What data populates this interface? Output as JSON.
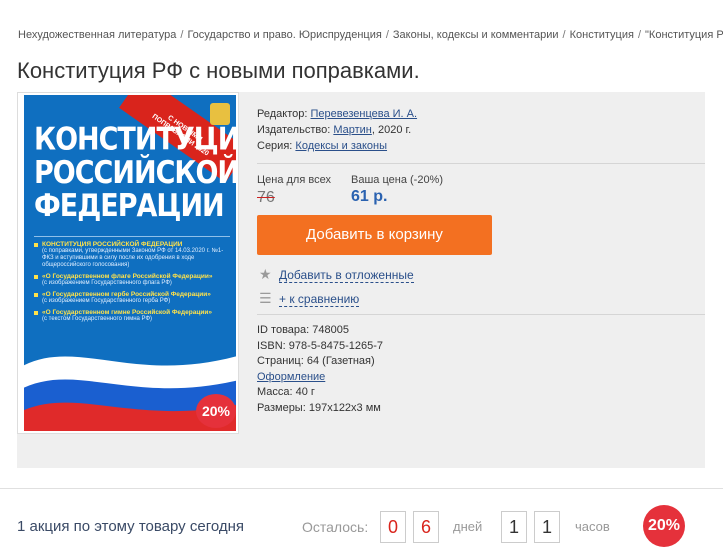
{
  "breadcrumbs": [
    "Нехудожественная литература",
    "Государство и право. Юриспруденция",
    "Законы, кодексы и комментарии",
    "Конституция",
    "\"Конституция РФ с"
  ],
  "breadcrumb_separator": "/",
  "title": "Конституция РФ с новыми поправками.",
  "cover": {
    "title_line1": "КОНСТИТУЦИЯ",
    "title_line2": "РОССИЙСКОЙ",
    "title_line3": "ФЕДЕРАЦИИ",
    "band_text": "С НОВЫМИ ПОПРАВКАМИ 2020",
    "item1_title": "КОНСТИТУЦИЯ РОССИЙСКОЙ ФЕДЕРАЦИИ",
    "item1_sub": "(с поправками, утвержденными Законом РФ от 14.03.2020 г. №1-ФКЗ и вступившими в силу после их одобрения в ходе общероссийского голосования)",
    "item2_title": "«О Государственном флаге Российской Федерации»",
    "item2_sub": "(с изображением Государственного флага РФ)",
    "item3_title": "«О Государственном гербе Российской Федерации»",
    "item3_sub": "(с изображением Государственного герба РФ)",
    "item4_title": "«О Государственном гимне Российской Федерации»",
    "item4_sub": "(с текстом Государственного гимна РФ)",
    "discount_badge": "20%"
  },
  "meta": {
    "editor_label": "Редактор:",
    "editor_value": "Перевезенцева И. А.",
    "publisher_label": "Издательство:",
    "publisher_value": "Мартин",
    "publisher_year": ", 2020 г.",
    "series_label": "Серия:",
    "series_value": "Кодексы и законы"
  },
  "price": {
    "all_label": "Цена для всех",
    "old_price": "76",
    "your_label": "Ваша цена (-20%)",
    "new_price": "61 р."
  },
  "actions": {
    "add_to_cart": "Добавить в корзину",
    "wishlist": "Добавить в отложенные",
    "compare": "+ к сравнению"
  },
  "specs": {
    "id_label": "ID товара:",
    "id_value": "748005",
    "isbn_label": "ISBN:",
    "isbn_value": "978-5-8475-1265-7",
    "pages_label": "Страниц:",
    "pages_value": "64 (Газетная)",
    "design_link": "Оформление",
    "mass_label": "Масса:",
    "mass_value": "40 г",
    "size_label": "Размеры:",
    "size_value": "197x122x3 мм"
  },
  "promo": {
    "text": "1 акция по этому товару сегодня",
    "left_label": "Осталось:",
    "days_digit1": "0",
    "days_digit2": "6",
    "days_label": "дней",
    "hours_digit1": "1",
    "hours_digit2": "1",
    "hours_label": "часов",
    "badge": "20%"
  },
  "colors": {
    "accent_orange": "#f37021",
    "price_blue": "#2a62b0",
    "link_blue": "#2a4f8a",
    "badge_red": "#e5313b",
    "cover_blue": "#0f6fc0"
  }
}
